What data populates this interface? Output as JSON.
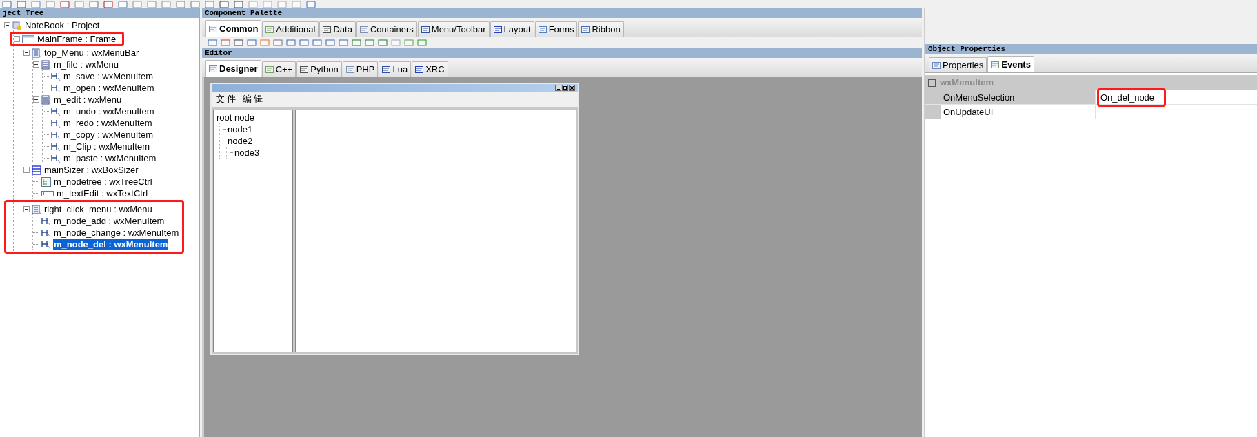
{
  "project_tree": {
    "title": "ject Tree",
    "items": [
      {
        "label": "NoteBook : Project",
        "kind": "project",
        "selected": false,
        "expanded": true,
        "children": [
          {
            "label": "MainFrame : Frame",
            "kind": "frame",
            "selected": false,
            "expanded": true,
            "highlighted": true,
            "children": [
              {
                "label": "top_Menu : wxMenuBar",
                "kind": "menubar",
                "selected": false,
                "expanded": true,
                "children": [
                  {
                    "label": "m_file : wxMenu",
                    "kind": "menu",
                    "selected": false,
                    "expanded": true,
                    "children": [
                      {
                        "label": "m_save : wxMenuItem",
                        "kind": "menuitem",
                        "selected": false
                      },
                      {
                        "label": "m_open : wxMenuItem",
                        "kind": "menuitem",
                        "selected": false
                      }
                    ]
                  },
                  {
                    "label": "m_edit : wxMenu",
                    "kind": "menu",
                    "selected": false,
                    "expanded": true,
                    "children": [
                      {
                        "label": "m_undo : wxMenuItem",
                        "kind": "menuitem",
                        "selected": false
                      },
                      {
                        "label": "m_redo : wxMenuItem",
                        "kind": "menuitem",
                        "selected": false
                      },
                      {
                        "label": "m_copy : wxMenuItem",
                        "kind": "menuitem",
                        "selected": false
                      },
                      {
                        "label": "m_Clip : wxMenuItem",
                        "kind": "menuitem",
                        "selected": false
                      },
                      {
                        "label": "m_paste : wxMenuItem",
                        "kind": "menuitem",
                        "selected": false
                      }
                    ]
                  }
                ]
              },
              {
                "label": "mainSizer : wxBoxSizer",
                "kind": "sizer",
                "selected": false,
                "expanded": true,
                "children": [
                  {
                    "label": "m_nodetree : wxTreeCtrl",
                    "kind": "treectrl",
                    "selected": false
                  },
                  {
                    "label": "m_textEdit : wxTextCtrl",
                    "kind": "textctrl",
                    "selected": false
                  }
                ]
              },
              {
                "label": "right_click_menu : wxMenu",
                "kind": "menu",
                "selected": false,
                "expanded": true,
                "group_highlighted": true,
                "children": [
                  {
                    "label": "m_node_add : wxMenuItem",
                    "kind": "menuitem",
                    "selected": false
                  },
                  {
                    "label": "m_node_change : wxMenuItem",
                    "kind": "menuitem",
                    "selected": false
                  },
                  {
                    "label": "m_node_del : wxMenuItem",
                    "kind": "menuitem",
                    "selected": true
                  }
                ]
              }
            ]
          }
        ]
      }
    ]
  },
  "component_palette": {
    "title": "Component Palette",
    "tabs": [
      {
        "label": "Common",
        "selected": true
      },
      {
        "label": "Additional",
        "selected": false
      },
      {
        "label": "Data",
        "selected": false
      },
      {
        "label": "Containers",
        "selected": false
      },
      {
        "label": "Menu/Toolbar",
        "selected": false
      },
      {
        "label": "Layout",
        "selected": false
      },
      {
        "label": "Forms",
        "selected": false
      },
      {
        "label": "Ribbon",
        "selected": false
      }
    ]
  },
  "editor": {
    "title": "Editor",
    "tabs": [
      {
        "label": "Designer",
        "selected": true
      },
      {
        "label": "C++",
        "selected": false
      },
      {
        "label": "Python",
        "selected": false
      },
      {
        "label": "PHP",
        "selected": false
      },
      {
        "label": "Lua",
        "selected": false
      },
      {
        "label": "XRC",
        "selected": false
      }
    ],
    "frame": {
      "menus": [
        "文件",
        "编辑"
      ],
      "tree": [
        {
          "label": "root node",
          "children": [
            {
              "label": "node1"
            },
            {
              "label": "node2",
              "children": [
                {
                  "label": "node3"
                }
              ]
            }
          ]
        }
      ]
    }
  },
  "object_properties": {
    "title": "Object Properties",
    "tabs": [
      {
        "label": "Properties",
        "selected": false
      },
      {
        "label": "Events",
        "selected": true
      }
    ],
    "category": {
      "label": "wxMenuItem",
      "expanded": true
    },
    "rows": [
      {
        "name": "OnMenuSelection",
        "value": "On_del_node",
        "selected": true,
        "highlighted": true
      },
      {
        "name": "OnUpdateUI",
        "selected": false,
        "highlighted": false
      }
    ]
  }
}
